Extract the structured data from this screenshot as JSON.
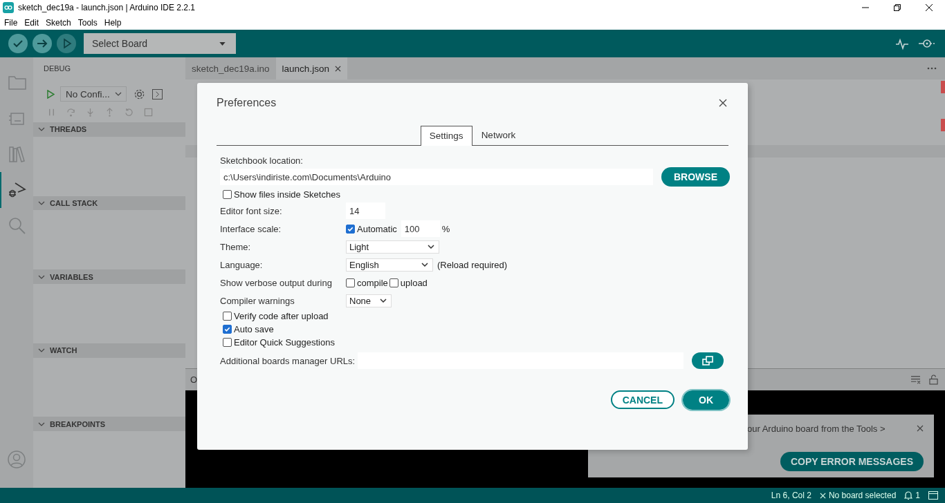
{
  "window": {
    "title": "sketch_dec19a - launch.json | Arduino IDE 2.2.1"
  },
  "menu": [
    "File",
    "Edit",
    "Sketch",
    "Tools",
    "Help"
  ],
  "toolbar": {
    "board_select": "Select Board"
  },
  "activity_bar": [
    {
      "kind": "folder",
      "selected": false
    },
    {
      "kind": "board",
      "selected": false
    },
    {
      "kind": "library",
      "selected": false
    },
    {
      "kind": "debug",
      "selected": true
    },
    {
      "kind": "search",
      "selected": false
    }
  ],
  "debug_panel": {
    "title": "DEBUG",
    "config": "No Confi...",
    "sections": [
      {
        "label": "THREADS",
        "expanded": true
      },
      {
        "label": "CALL STACK",
        "expanded": true
      },
      {
        "label": "VARIABLES",
        "expanded": true
      },
      {
        "label": "WATCH",
        "expanded": true
      },
      {
        "label": "BREAKPOINTS",
        "expanded": true
      }
    ]
  },
  "editor_tabs": [
    {
      "label": "sketch_dec19a.ino",
      "selected": false
    },
    {
      "label": "launch.json",
      "selected": true
    }
  ],
  "bottom_panel": {
    "tab": "O"
  },
  "notification": {
    "message": "our Arduino board from the Tools >",
    "button": "COPY ERROR MESSAGES"
  },
  "status_bar": {
    "position": "Ln 6, Col 2",
    "board": "No board selected",
    "notifications": "1"
  },
  "dialog": {
    "title": "Preferences",
    "tabs": [
      {
        "label": "Settings",
        "selected": true
      },
      {
        "label": "Network",
        "selected": false
      }
    ],
    "sketchbook": {
      "label": "Sketchbook location:",
      "value": "c:\\Users\\indiriste.com\\Documents\\Arduino",
      "button": "BROWSE"
    },
    "show_files": {
      "label": "Show files inside Sketches",
      "checked": false
    },
    "font_size": {
      "label": "Editor font size:",
      "value": "14"
    },
    "scale": {
      "label": "Interface scale:",
      "automatic_label": "Automatic",
      "automatic": true,
      "value": "100",
      "unit": "%"
    },
    "theme": {
      "label": "Theme:",
      "value": "Light"
    },
    "language": {
      "label": "Language:",
      "value": "English",
      "note": "(Reload required)"
    },
    "verbose": {
      "label": "Show verbose output during",
      "options": [
        {
          "label": "compile",
          "checked": false
        },
        {
          "label": "upload",
          "checked": false
        }
      ]
    },
    "warnings": {
      "label": "Compiler warnings",
      "value": "None"
    },
    "options": [
      {
        "label": "Verify code after upload",
        "checked": false
      },
      {
        "label": "Auto save",
        "checked": true
      },
      {
        "label": "Editor Quick Suggestions",
        "checked": false
      }
    ],
    "urls": {
      "label": "Additional boards manager URLs:"
    },
    "buttons": {
      "cancel": "CANCEL",
      "ok": "OK"
    }
  }
}
